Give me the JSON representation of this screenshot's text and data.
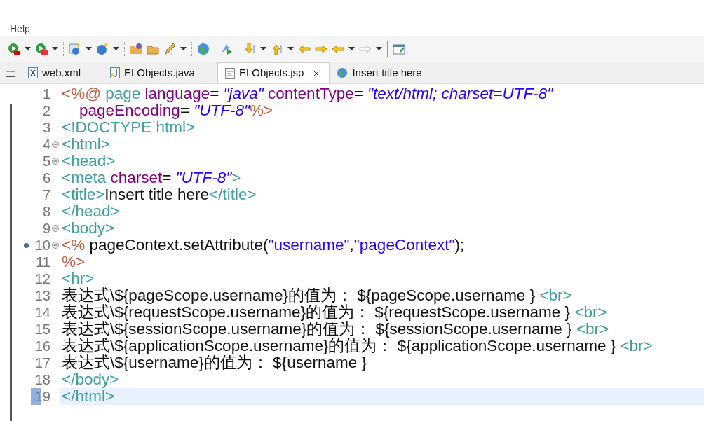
{
  "menu_bar": {
    "items": [
      "Help"
    ]
  },
  "tabs": [
    {
      "label": "web.xml",
      "kind": "xml",
      "selected": false
    },
    {
      "label": "ELObjects.java",
      "kind": "java",
      "selected": false
    },
    {
      "label": "ELObjects.jsp",
      "kind": "jsp",
      "selected": true
    },
    {
      "label": "Insert title here",
      "kind": "web",
      "selected": false
    }
  ],
  "editor": {
    "lines": [
      {
        "number": "1",
        "foldable": false,
        "bookmark": false,
        "current": false,
        "tokens": [
          {
            "kind": "directive",
            "text": "<%@"
          },
          {
            "kind": "tag",
            "text": " page"
          },
          {
            "kind": "attr",
            "text": " language"
          },
          {
            "kind": "text",
            "text": "="
          },
          {
            "kind": "value",
            "text": " \"java\""
          },
          {
            "kind": "attr",
            "text": " contentType"
          },
          {
            "kind": "text",
            "text": "="
          },
          {
            "kind": "value",
            "text": " \"text/html; charset=UTF-8\""
          }
        ]
      },
      {
        "number": "2",
        "foldable": false,
        "bookmark": false,
        "current": false,
        "tokens": [
          {
            "kind": "attr",
            "text": "    pageEncoding"
          },
          {
            "kind": "text",
            "text": "="
          },
          {
            "kind": "value",
            "text": " \"UTF-8\""
          },
          {
            "kind": "directive",
            "text": "%>"
          }
        ]
      },
      {
        "number": "3",
        "foldable": false,
        "bookmark": false,
        "current": false,
        "tokens": [
          {
            "kind": "tag",
            "text": "<!DOCTYPE html>"
          }
        ]
      },
      {
        "number": "4",
        "foldable": true,
        "bookmark": false,
        "current": false,
        "tokens": [
          {
            "kind": "tag",
            "text": "<html>"
          }
        ]
      },
      {
        "number": "5",
        "foldable": true,
        "bookmark": false,
        "current": false,
        "tokens": [
          {
            "kind": "tag",
            "text": "<head>"
          }
        ]
      },
      {
        "number": "6",
        "foldable": false,
        "bookmark": false,
        "current": false,
        "tokens": [
          {
            "kind": "tag",
            "text": "<meta"
          },
          {
            "kind": "attr",
            "text": " charset"
          },
          {
            "kind": "text",
            "text": "="
          },
          {
            "kind": "value",
            "text": " \"UTF-8\""
          },
          {
            "kind": "tag",
            "text": ">"
          }
        ]
      },
      {
        "number": "7",
        "foldable": false,
        "bookmark": false,
        "current": false,
        "tokens": [
          {
            "kind": "tag",
            "text": "<title>"
          },
          {
            "kind": "text",
            "text": "Insert title here"
          },
          {
            "kind": "tag",
            "text": "</title>"
          }
        ]
      },
      {
        "number": "8",
        "foldable": false,
        "bookmark": false,
        "current": false,
        "tokens": [
          {
            "kind": "tag",
            "text": "</head>"
          }
        ]
      },
      {
        "number": "9",
        "foldable": true,
        "bookmark": false,
        "current": false,
        "tokens": [
          {
            "kind": "tag",
            "text": "<body>"
          }
        ]
      },
      {
        "number": "10",
        "foldable": true,
        "bookmark": true,
        "current": false,
        "tokens": [
          {
            "kind": "directive",
            "text": "<%"
          },
          {
            "kind": "text",
            "text": " pageContext.setAttribute("
          },
          {
            "kind": "string",
            "text": "\"username\""
          },
          {
            "kind": "text",
            "text": ","
          },
          {
            "kind": "string",
            "text": "\"pageContext\""
          },
          {
            "kind": "text",
            "text": ");"
          }
        ]
      },
      {
        "number": "11",
        "foldable": false,
        "bookmark": false,
        "current": false,
        "tokens": [
          {
            "kind": "directive",
            "text": "%>"
          }
        ]
      },
      {
        "number": "12",
        "foldable": false,
        "bookmark": false,
        "current": false,
        "tokens": [
          {
            "kind": "tag",
            "text": "<hr>"
          }
        ]
      },
      {
        "number": "13",
        "foldable": false,
        "bookmark": false,
        "current": false,
        "tokens": [
          {
            "kind": "text",
            "text": "表达式\\${pageScope.username}的值为： ${pageScope.username } "
          },
          {
            "kind": "tag",
            "text": "<br>"
          }
        ]
      },
      {
        "number": "14",
        "foldable": false,
        "bookmark": false,
        "current": false,
        "tokens": [
          {
            "kind": "text",
            "text": "表达式\\${requestScope.username}的值为： ${requestScope.username } "
          },
          {
            "kind": "tag",
            "text": "<br>"
          }
        ]
      },
      {
        "number": "15",
        "foldable": false,
        "bookmark": false,
        "current": false,
        "tokens": [
          {
            "kind": "text",
            "text": "表达式\\${sessionScope.username}的值为： ${sessionScope.username } "
          },
          {
            "kind": "tag",
            "text": "<br>"
          }
        ]
      },
      {
        "number": "16",
        "foldable": false,
        "bookmark": false,
        "current": false,
        "tokens": [
          {
            "kind": "text",
            "text": "表达式\\${applicationScope.username}的值为： ${applicationScope.username } "
          },
          {
            "kind": "tag",
            "text": "<br>"
          }
        ]
      },
      {
        "number": "17",
        "foldable": false,
        "bookmark": false,
        "current": false,
        "tokens": [
          {
            "kind": "text",
            "text": "表达式\\${username}的值为： ${username }"
          }
        ]
      },
      {
        "number": "18",
        "foldable": false,
        "bookmark": false,
        "current": false,
        "tokens": [
          {
            "kind": "tag",
            "text": "</body>"
          }
        ]
      },
      {
        "number": "19",
        "foldable": false,
        "bookmark": false,
        "current": true,
        "tokens": [
          {
            "kind": "tag",
            "text": "</html>"
          }
        ]
      }
    ]
  }
}
